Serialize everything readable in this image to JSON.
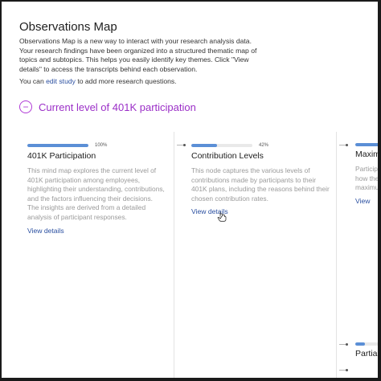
{
  "page": {
    "title": "Observations Map",
    "intro": "Observations Map is a new way to interact with your research analysis data. Your research findings have been organized into a structured thematic map of topics and subtopics. This helps you easily identify key themes. Click \"View details\" to access the transcripts behind each observation.",
    "edit_prefix": "You can ",
    "edit_link": "edit study",
    "edit_suffix": " to add more research questions."
  },
  "topic": {
    "toggle_symbol": "−",
    "title": "Current level of 401K participation"
  },
  "cards": [
    {
      "progress_pct": 100,
      "progress_label": "100%",
      "title": "401K Participation",
      "description": "This mind map explores the current level of 401K participation among employees, highlighting their understanding, contributions, and the factors influencing their decisions. The insights are derived from a detailed analysis of participant responses.",
      "link": "View details"
    },
    {
      "progress_pct": 42,
      "progress_label": "42%",
      "title": "Contribution Levels",
      "description": "This node captures the various levels of contributions made by participants to their 401K plans, including the reasons behind their chosen contribution rates.",
      "link": "View details"
    },
    {
      "progress_pct": 60,
      "title": "Maxim",
      "description": "Particip how the maximu",
      "link": "View"
    },
    {
      "progress_pct": 20,
      "title": "Partial"
    }
  ],
  "colors": {
    "accent": "#9b2fc7",
    "progress": "#5b8fd6",
    "link": "#2a4fa0"
  }
}
